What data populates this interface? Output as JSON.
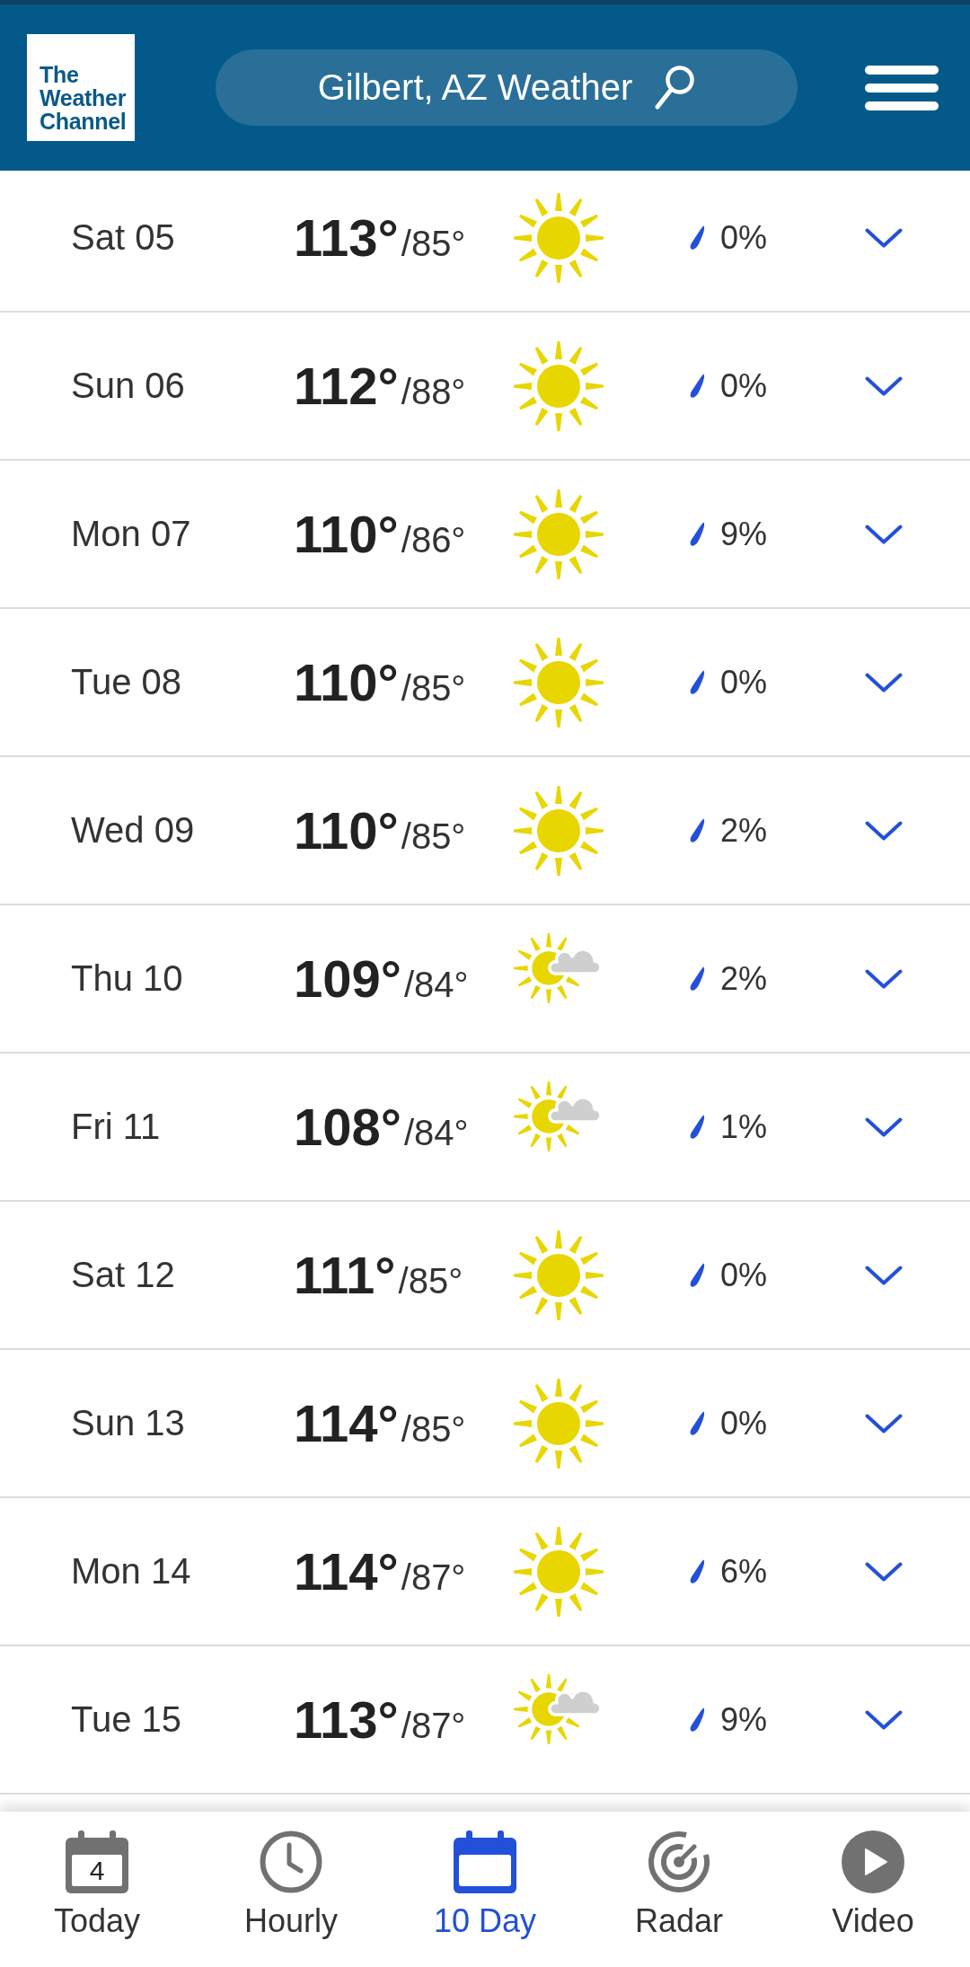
{
  "header": {
    "logo": "The Weather Channel",
    "search_label": "Gilbert, AZ Weather"
  },
  "forecast": [
    {
      "day": "Sat 05",
      "high": "113°",
      "low": "/85°",
      "kind": "sunny",
      "precip": "0%",
      "expanded": false
    },
    {
      "day": "Sun 06",
      "high": "112°",
      "low": "/88°",
      "kind": "sunny",
      "precip": "0%",
      "expanded": false
    },
    {
      "day": "Mon 07",
      "high": "110°",
      "low": "/86°",
      "kind": "sunny",
      "precip": "9%",
      "expanded": false
    },
    {
      "day": "Tue 08",
      "high": "110°",
      "low": "/85°",
      "kind": "sunny",
      "precip": "0%",
      "expanded": false
    },
    {
      "day": "Wed 09",
      "high": "110°",
      "low": "/85°",
      "kind": "sunny",
      "precip": "2%",
      "expanded": false
    },
    {
      "day": "Thu 10",
      "high": "109°",
      "low": "/84°",
      "kind": "partly-cloudy",
      "precip": "2%",
      "expanded": false
    },
    {
      "day": "Fri 11",
      "high": "108°",
      "low": "/84°",
      "kind": "partly-cloudy",
      "precip": "1%",
      "expanded": false
    },
    {
      "day": "Sat 12",
      "high": "111°",
      "low": "/85°",
      "kind": "sunny",
      "precip": "0%",
      "expanded": false
    },
    {
      "day": "Sun 13",
      "high": "114°",
      "low": "/85°",
      "kind": "sunny",
      "precip": "0%",
      "expanded": false
    },
    {
      "day": "Mon 14",
      "high": "114°",
      "low": "/87°",
      "kind": "sunny",
      "precip": "6%",
      "expanded": false
    },
    {
      "day": "Tue 15",
      "high": "113°",
      "low": "/87°",
      "kind": "partly-cloudy",
      "precip": "9%",
      "expanded": false
    }
  ],
  "nav_tabs": [
    {
      "label": "Today",
      "kind": "calendar-day",
      "date": "4",
      "selected": false
    },
    {
      "label": "Hourly",
      "kind": "clock",
      "selected": false
    },
    {
      "label": "10 Day",
      "kind": "calendar",
      "selected": true
    },
    {
      "label": "Radar",
      "kind": "radar",
      "selected": false
    },
    {
      "label": "Video",
      "kind": "play",
      "selected": false
    }
  ]
}
